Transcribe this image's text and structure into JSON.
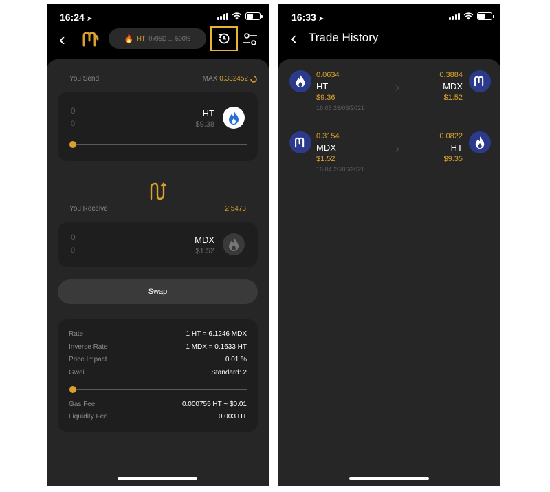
{
  "colors": {
    "accent": "#d9a02c",
    "highlight_box": "#e8b331",
    "ht_blue": "#2a6fd6",
    "mdx_navy": "#2c3a8c"
  },
  "left": {
    "status": {
      "time": "16:24"
    },
    "header": {
      "wallet_network": "HT",
      "wallet_address": "0x95D ... 500f6"
    },
    "send": {
      "label": "You Send",
      "max_label": "MAX",
      "max_value": "0.332452",
      "amount": "0",
      "amount_usd": "0",
      "token": "HT",
      "token_usd": "$9.38",
      "slider_fraction": 0
    },
    "receive": {
      "label": "You Receive",
      "value": "2.5473",
      "amount": "0",
      "amount_usd": "0",
      "token": "MDX",
      "token_usd": "$1.52"
    },
    "swap_button": "Swap",
    "details": {
      "rate_label": "Rate",
      "rate_value": "1 HT = 6.1246 MDX",
      "inverse_label": "Inverse Rate",
      "inverse_value": "1 MDX = 0.1633 HT",
      "impact_label": "Price Impact",
      "impact_value": "0.01 %",
      "gwei_label": "Gwei",
      "gwei_value": "Standard: 2",
      "gas_label": "Gas Fee",
      "gas_value": "0.000755 HT ~ $0.01",
      "liq_label": "Liquidity Fee",
      "liq_value": "0.003 HT"
    }
  },
  "right": {
    "status": {
      "time": "16:33"
    },
    "title": "Trade History",
    "trades": [
      {
        "from_amount": "0.0634",
        "from_token": "HT",
        "from_usd": "$9.36",
        "time": "16:05 26/06/2021",
        "to_amount": "0.3884",
        "to_token": "MDX",
        "to_usd": "$1.52"
      },
      {
        "from_amount": "0.3154",
        "from_token": "MDX",
        "from_usd": "$1.52",
        "time": "16:04 26/06/2021",
        "to_amount": "0.0822",
        "to_token": "HT",
        "to_usd": "$9.35"
      }
    ]
  }
}
